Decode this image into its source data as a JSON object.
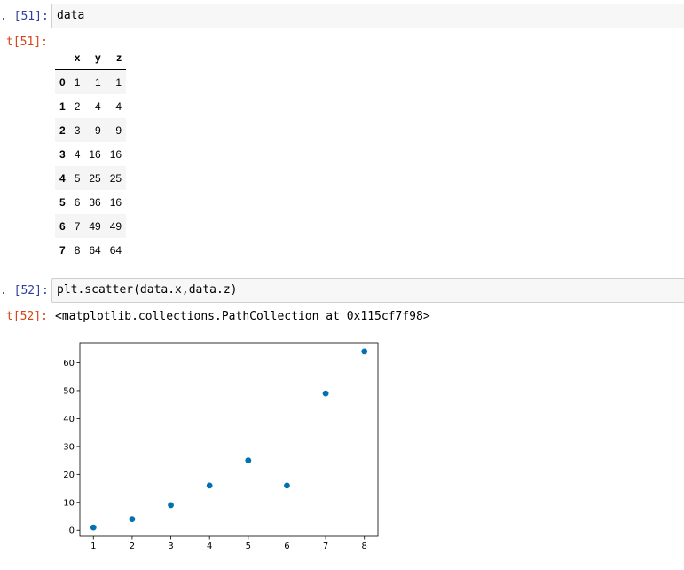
{
  "cells": [
    {
      "in_prompt": ". [51]:",
      "code": "data",
      "out_prompt": "t[51]:"
    },
    {
      "in_prompt": ". [52]:",
      "code": "plt.scatter(data.x,data.z)",
      "out_prompt": "t[52]:",
      "out_text": "<matplotlib.collections.PathCollection at 0x115cf7f98>"
    }
  ],
  "dataframe": {
    "columns": [
      "x",
      "y",
      "z"
    ],
    "rows": [
      {
        "index": "0",
        "x": "1",
        "y": "1",
        "z": "1"
      },
      {
        "index": "1",
        "x": "2",
        "y": "4",
        "z": "4"
      },
      {
        "index": "2",
        "x": "3",
        "y": "9",
        "z": "9"
      },
      {
        "index": "3",
        "x": "4",
        "y": "16",
        "z": "16"
      },
      {
        "index": "4",
        "x": "5",
        "y": "25",
        "z": "25"
      },
      {
        "index": "5",
        "x": "6",
        "y": "36",
        "z": "16"
      },
      {
        "index": "6",
        "x": "7",
        "y": "49",
        "z": "49"
      },
      {
        "index": "7",
        "x": "8",
        "y": "64",
        "z": "64"
      }
    ]
  },
  "chart_data": {
    "type": "scatter",
    "x": [
      1,
      2,
      3,
      4,
      5,
      6,
      7,
      8
    ],
    "y": [
      1,
      4,
      9,
      16,
      25,
      16,
      49,
      64
    ],
    "xticks": [
      1,
      2,
      3,
      4,
      5,
      6,
      7,
      8
    ],
    "yticks": [
      0,
      10,
      20,
      30,
      40,
      50,
      60
    ],
    "xlim": [
      0.65,
      8.35
    ],
    "ylim": [
      -2.15,
      67.15
    ],
    "grid": false,
    "marker_color": "#0072b2"
  }
}
